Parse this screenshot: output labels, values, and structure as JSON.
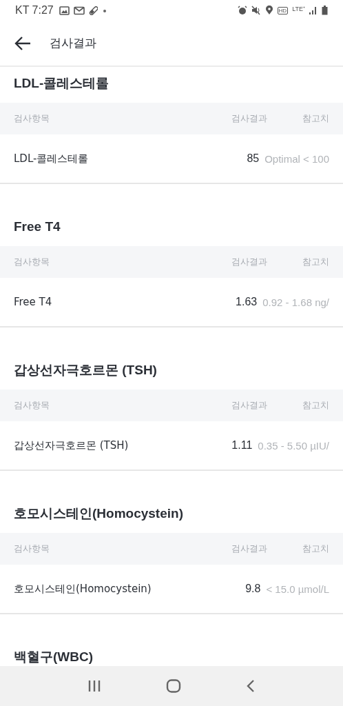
{
  "status_bar": {
    "carrier_time": "KT 7:27",
    "hd_badge": "HD",
    "network": "LTE⁺"
  },
  "app_bar": {
    "title": "검사결과"
  },
  "sections": [
    {
      "title": "LDL-콜레스테롤",
      "columns": [
        "검사항목",
        "검사결과",
        "참고치"
      ],
      "rows": [
        {
          "item": "LDL-콜레스테롤",
          "result": "85",
          "reference": "Optimal < 100"
        }
      ]
    },
    {
      "title": "Free T4",
      "columns": [
        "검사항목",
        "검사결과",
        "참고치"
      ],
      "rows": [
        {
          "item": "Free T4",
          "result": "1.63",
          "reference": "0.92 - 1.68 ng/"
        }
      ]
    },
    {
      "title": "갑상선자극호르몬 (TSH)",
      "columns": [
        "검사항목",
        "검사결과",
        "참고치"
      ],
      "rows": [
        {
          "item": "갑상선자극호르몬 (TSH)",
          "result": "1.11",
          "reference": "0.35 - 5.50 µIU/"
        }
      ]
    },
    {
      "title": "호모시스테인(Homocystein)",
      "columns": [
        "검사항목",
        "검사결과",
        "참고치"
      ],
      "rows": [
        {
          "item": "호모시스테인(Homocystein)",
          "result": "9.8",
          "reference": "< 15.0 µmol/L"
        }
      ]
    },
    {
      "title": "백혈구(WBC)"
    }
  ]
}
